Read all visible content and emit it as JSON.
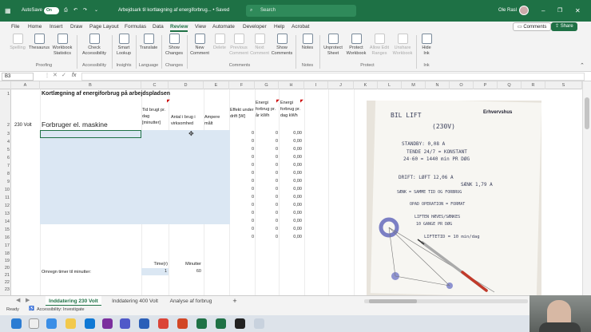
{
  "titlebar": {
    "autosave_label": "AutoSave",
    "autosave_state": "On",
    "doc_title": "Arbejdsark til kortlægning af energiforbrug... • Saved",
    "search_placeholder": "Search",
    "user_name": "Ole Rasl"
  },
  "menu": {
    "items": [
      "File",
      "Home",
      "Insert",
      "Draw",
      "Page Layout",
      "Formulas",
      "Data",
      "Review",
      "View",
      "Automate",
      "Developer",
      "Help",
      "Acrobat"
    ],
    "active": "Review",
    "comments_label": "Comments",
    "share_label": "Share"
  },
  "ribbon": {
    "buttons": {
      "spelling": "Spelling",
      "thesaurus": "Thesaurus",
      "workbook_statistics": "Workbook Statistics",
      "check_accessibility": "Check Accessibility",
      "smart_lookup": "Smart Lookup",
      "translate": "Translate",
      "show_changes": "Show Changes",
      "new_comment": "New Comment",
      "delete": "Delete",
      "previous_comment": "Previous Comment",
      "next_comment": "Next Comment",
      "show_comments": "Show Comments",
      "notes": "Notes",
      "unprotect_sheet": "Unprotect Sheet",
      "protect_workbook": "Protect Workbook",
      "allow_edit_ranges": "Allow Edit Ranges",
      "unshare_workbook": "Unshare Workbook",
      "hide_ink": "Hide Ink"
    },
    "groups": {
      "proofing": "Proofing",
      "accessibility": "Accessibility",
      "insights": "Insights",
      "language": "Language",
      "changes": "Changes",
      "comments": "Comments",
      "notes": "Notes",
      "protect": "Protect",
      "ink": "Ink"
    }
  },
  "formula_bar": {
    "name_box": "B3",
    "fx": "fx",
    "content": ""
  },
  "columns": [
    "A",
    "B",
    "C",
    "D",
    "E",
    "F",
    "G",
    "H",
    "I",
    "J",
    "K",
    "L",
    "M",
    "N",
    "O",
    "P",
    "Q",
    "R",
    "S"
  ],
  "rows": [
    "1",
    "2",
    "3",
    "4",
    "5",
    "6",
    "7",
    "8",
    "9",
    "10",
    "11",
    "12",
    "13",
    "14",
    "15",
    "16",
    "17",
    "18",
    "19",
    "20",
    "21",
    "22",
    "23",
    "24"
  ],
  "sheet": {
    "title": "Kortlægning af energiforbrug på arbejdspladsen",
    "a2": "230 Volt",
    "b2": "Forbruger el. maskine",
    "headers": {
      "c": "Tid brugt pr. dag [minutter]",
      "d": "Antal i brug i virksomhed",
      "e": "Ampere målt",
      "f": "Effekt under drift [W]",
      "g": "Energi forbrug pr. år kWh",
      "h": "Energi forbrug pr. dag kWh"
    },
    "rows": [
      {
        "f": "0",
        "g": "0",
        "h": "0,00"
      },
      {
        "f": "0",
        "g": "0",
        "h": "0,00"
      },
      {
        "f": "0",
        "g": "0",
        "h": "0,00"
      },
      {
        "f": "0",
        "g": "0",
        "h": "0,00"
      },
      {
        "f": "0",
        "g": "0",
        "h": "0,00"
      },
      {
        "f": "0",
        "g": "0",
        "h": "0,00"
      },
      {
        "f": "0",
        "g": "0",
        "h": "0,00"
      },
      {
        "f": "0",
        "g": "0",
        "h": "0,00"
      },
      {
        "f": "0",
        "g": "0",
        "h": "0,00"
      },
      {
        "f": "0",
        "g": "0",
        "h": "0,00"
      },
      {
        "f": "0",
        "g": "0",
        "h": "0,00"
      },
      {
        "f": "0",
        "g": "0",
        "h": "0,00"
      },
      {
        "f": "0",
        "g": "0",
        "h": "0,00"
      },
      {
        "f": "0",
        "g": "0",
        "h": "0,00"
      }
    ],
    "timer_label": "Omregn timer til minutter:",
    "timer_header": "Time(r)",
    "minutter_header": "Minutter",
    "timer_value": "1",
    "minutter_value": "60"
  },
  "photo_notes": {
    "title": "BIL LIFT",
    "subtitle": "(230V)",
    "logo": "Erhvervshus",
    "lines": [
      "STANDBY: 0,08 A",
      "TENDE 24/7 = KONSTANT",
      "24·60 = 1440 min PR DØG",
      "DRIFT: LØFT 12,06 A",
      "SÆNK 1,79 A",
      "SÆNK = SAMME TID OG FORBRUG",
      "OPAD OPERATION = FORMAT",
      "LIFTEN HÆVES/SÆNKES",
      "10 GANGE PR DØG",
      "LIFTETID = 10 min/dag"
    ]
  },
  "tabs": {
    "items": [
      "Inddatering 230 Volt",
      "Inddatering 400 Volt",
      "Analyse af forbrug"
    ],
    "active": "Inddatering 230 Volt",
    "add": "+"
  },
  "status": {
    "ready": "Ready",
    "accessibility": "Accessibility: Investigate"
  },
  "colors": {
    "brand": "#1e7145",
    "input_fill": "#dbe7f3",
    "selected_border": "#1e7145"
  }
}
